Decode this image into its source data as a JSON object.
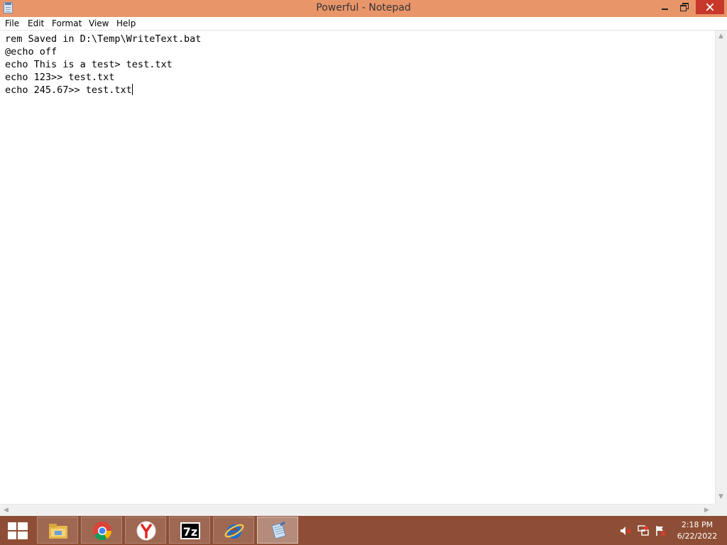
{
  "window": {
    "title": "Powerful - Notepad"
  },
  "menu": [
    "File",
    "Edit",
    "Format",
    "View",
    "Help"
  ],
  "editor": {
    "lines": [
      "rem Saved in D:\\Temp\\WriteText.bat",
      "@echo off",
      "echo This is a test> test.txt",
      "echo 123>> test.txt",
      "echo 245.67>> test.txt"
    ]
  },
  "taskbar": {
    "apps": [
      {
        "name": "file-explorer-icon",
        "active": false
      },
      {
        "name": "chrome-icon",
        "active": false
      },
      {
        "name": "yandex-browser-icon",
        "active": false
      },
      {
        "name": "7zip-icon",
        "active": false,
        "label": "7z"
      },
      {
        "name": "internet-explorer-icon",
        "active": false
      },
      {
        "name": "notepad-icon",
        "active": true
      }
    ],
    "clock_time": "2:18 PM",
    "clock_date": "6/22/2022"
  },
  "colors": {
    "titlebar": "#e9956a",
    "close_button": "#c7382b",
    "taskbar": "#8e4e35"
  }
}
